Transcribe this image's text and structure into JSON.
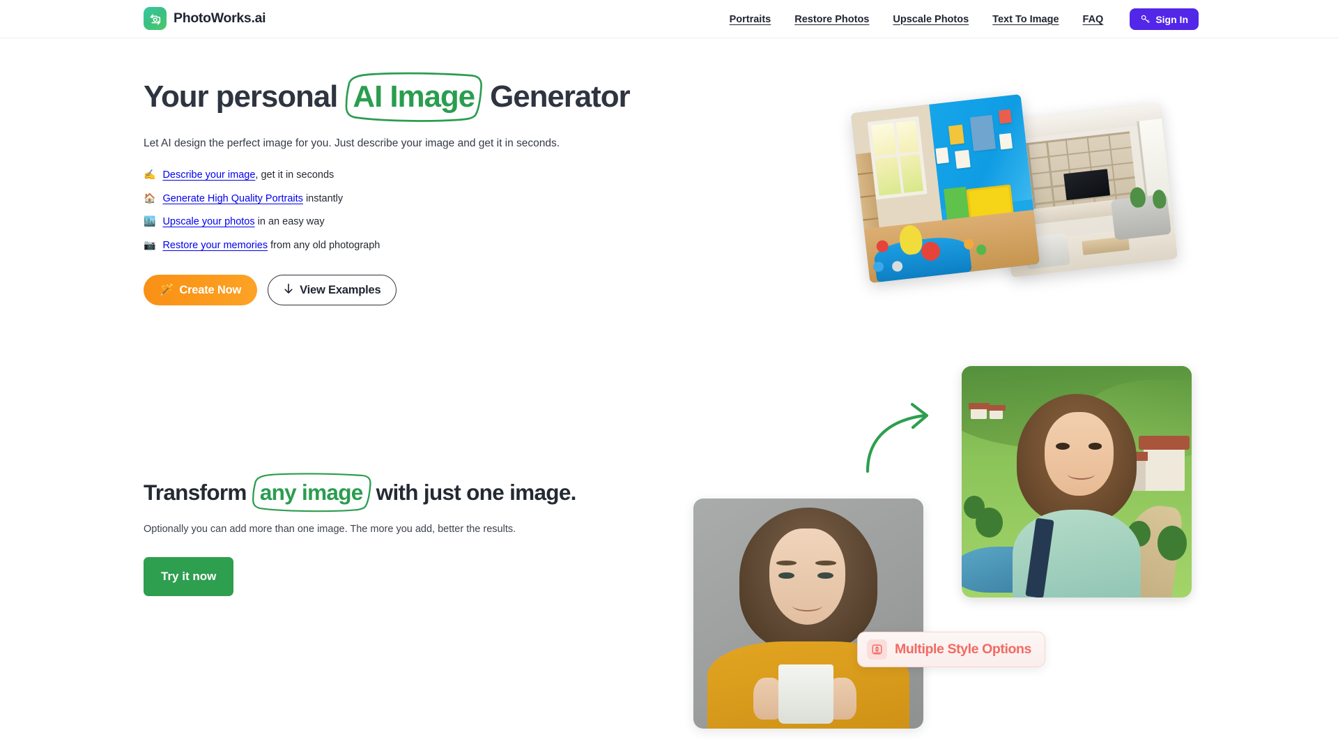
{
  "header": {
    "brand_name": "PhotoWorks.ai",
    "logo_icon": "camera-refresh-icon",
    "nav_items": [
      {
        "label": "Portraits"
      },
      {
        "label": "Restore Photos"
      },
      {
        "label": "Upscale Photos"
      },
      {
        "label": "Text To Image"
      },
      {
        "label": "FAQ"
      }
    ],
    "signin_label": "Sign In",
    "signin_icon": "key-icon",
    "signin_color": "#5227e8"
  },
  "hero": {
    "title_before": "Your personal",
    "title_highlight": "AI Image",
    "title_after": "Generator",
    "highlight_color": "#2a9d4f",
    "subtitle": "Let AI design the perfect image for you. Just describe your image and get it in seconds.",
    "features": [
      {
        "emoji": "✍️",
        "emoji_name": "writing-hand-emoji",
        "link": "Describe your image",
        "rest": ", get it in seconds"
      },
      {
        "emoji": "🏠",
        "emoji_name": "house-emoji",
        "link": "Generate High Quality Portraits",
        "rest": " instantly"
      },
      {
        "emoji": "🏙️",
        "emoji_name": "cityscape-emoji",
        "link": "Upscale your photos",
        "rest": " in an easy way"
      },
      {
        "emoji": "📷",
        "emoji_name": "camera-emoji",
        "link": "Restore your memories",
        "rest": " from any old photograph"
      }
    ],
    "create_label": "Create Now",
    "create_emoji": "🪄",
    "create_color": "#f99016",
    "examples_label": "View Examples",
    "examples_icon": "arrow-down-icon",
    "image_playroom_alt": "Colorful kids playroom with blue walls, toys and blue rug",
    "image_livingroom_alt": "Modern living room with wooden shelving, TV and sofa"
  },
  "transform": {
    "title_before": "Transform",
    "title_highlight": "any image",
    "title_after": "with just one image.",
    "highlight_color": "#2a9d4f",
    "subtitle": "Optionally you can add more than one image. The more you add, better the results.",
    "try_label": "Try it now",
    "try_color": "#2e9e4f",
    "arrow_icon": "curved-arrow-icon",
    "arrow_color": "#2e9e4f",
    "badge_label": "Multiple Style Options",
    "badge_icon": "download-box-icon",
    "badge_color": "#f26a63",
    "image_original_alt": "Woman in mustard sweater holding a white mug on gray background",
    "image_generated_alt": "AI generated portrait of woman in a green valley with village"
  }
}
